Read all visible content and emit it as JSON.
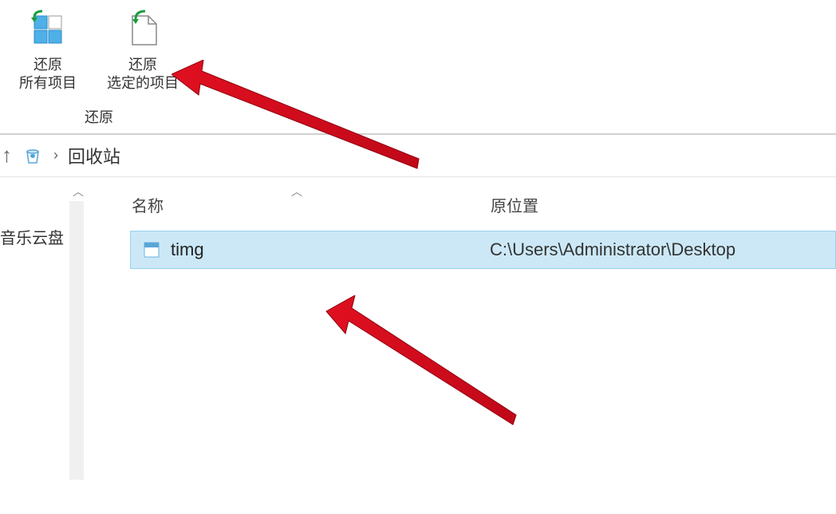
{
  "ribbon": {
    "restore_all": {
      "label_line1": "还原",
      "label_line2": "所有项目"
    },
    "restore_selected": {
      "label_line1": "还原",
      "label_line2": "选定的项目"
    },
    "group_label": "还原"
  },
  "breadcrumb": {
    "location": "回收站"
  },
  "sidebar": {
    "item1": "音乐云盘"
  },
  "columns": {
    "name": "名称",
    "original_location": "原位置"
  },
  "files": [
    {
      "name": "timg",
      "location": "C:\\Users\\Administrator\\Desktop"
    }
  ]
}
